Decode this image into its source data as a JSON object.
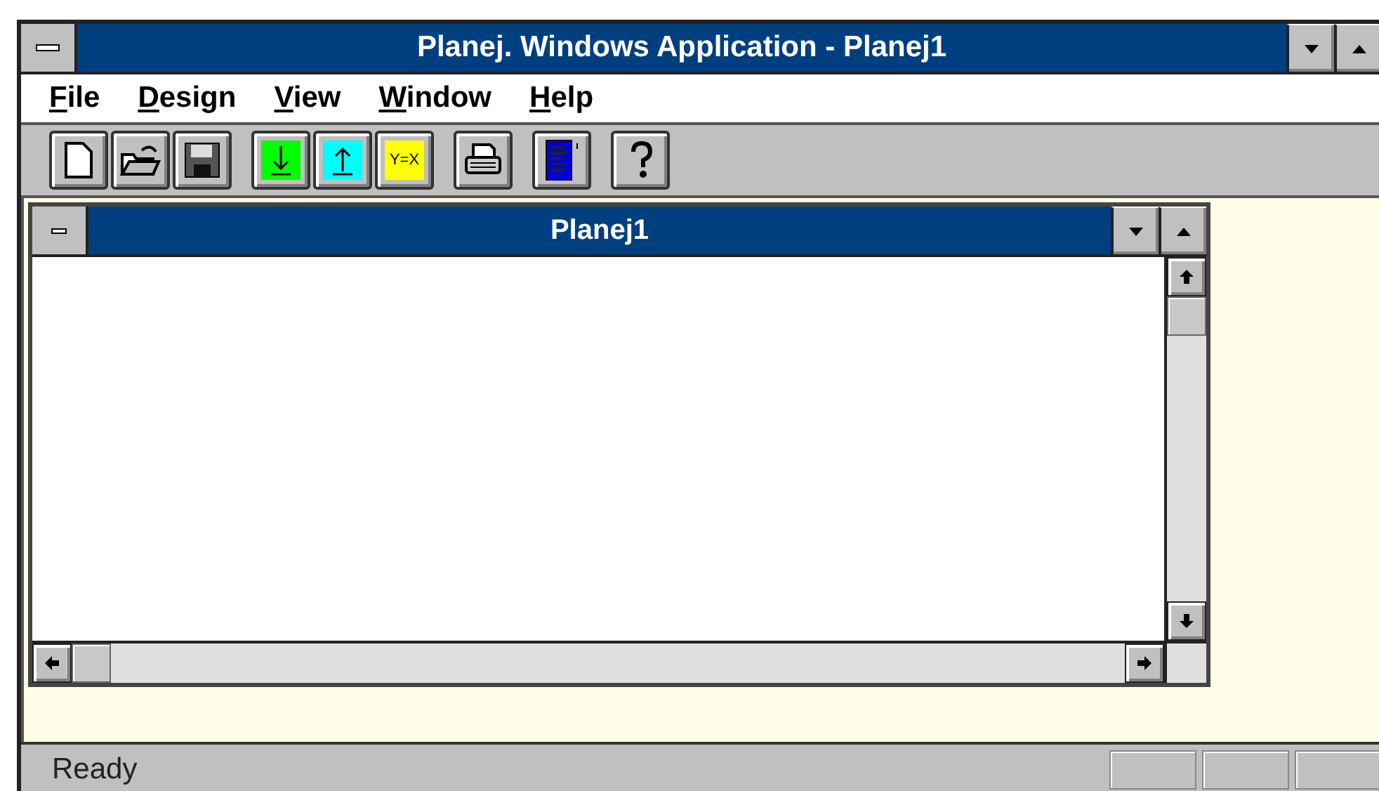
{
  "window": {
    "title": "Planej. Windows Application - Planej1"
  },
  "menu": [
    {
      "label": "File"
    },
    {
      "label": "Design"
    },
    {
      "label": "View"
    },
    {
      "label": "Window"
    },
    {
      "label": "Help"
    }
  ],
  "toolbar": [
    [
      {
        "kind": "new"
      },
      {
        "kind": "open"
      },
      {
        "kind": "save"
      }
    ],
    [
      {
        "kind": "down"
      },
      {
        "kind": "up"
      },
      {
        "kind": "swap",
        "label": "Y=X"
      }
    ],
    [
      {
        "kind": "print"
      }
    ],
    [
      {
        "kind": "report"
      }
    ],
    [
      {
        "kind": "help"
      }
    ]
  ],
  "child_window": {
    "title": "Planej1"
  },
  "status_bar": {
    "text": "Ready"
  }
}
